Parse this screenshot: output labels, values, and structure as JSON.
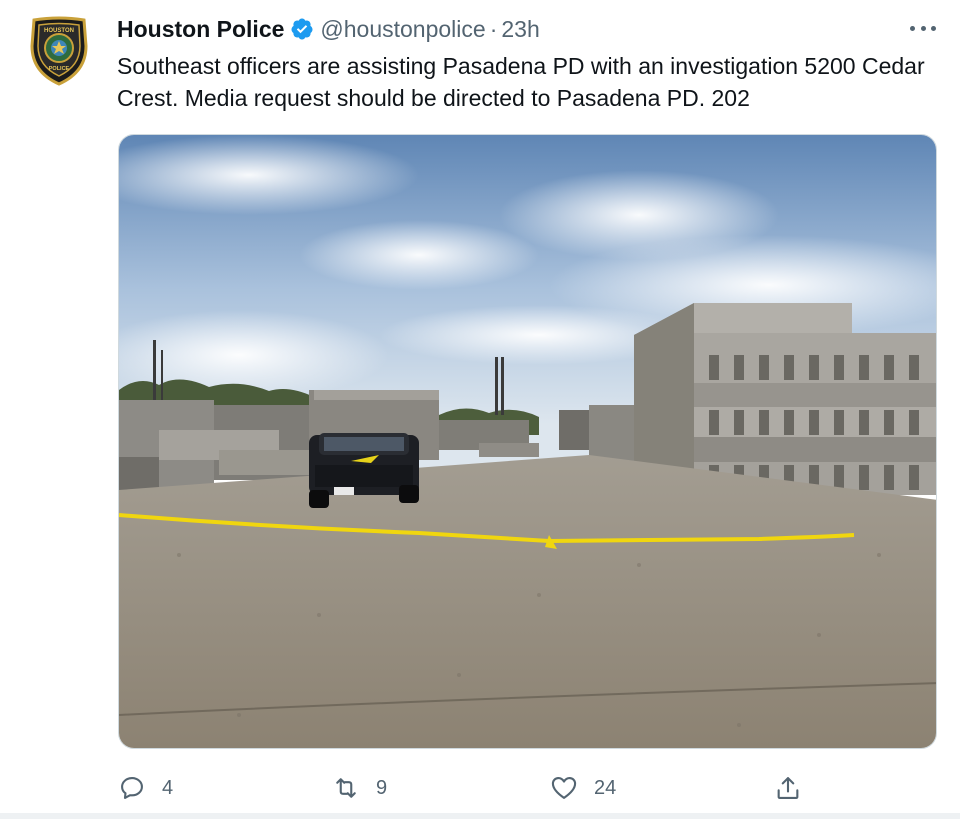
{
  "tweet": {
    "display_name": "Houston Police",
    "handle": "@houstonpolice",
    "separator": "·",
    "time": "23h",
    "text": "Southeast officers are assisting Pasadena PD with an investigation 5200 Cedar Crest. Media request should be directed to Pasadena PD. 202",
    "avatar_icon": "houston-police-badge-icon",
    "verified_icon": "verified-badge-icon",
    "verified_color": "#1d9bf0",
    "badge_text_top": "HOUSTON",
    "badge_text_bottom": "POLICE"
  },
  "media": {
    "description_icon": "photo-police-suv-crime-scene-tape"
  },
  "actions": {
    "reply_count": "4",
    "retweet_count": "9",
    "like_count": "24",
    "reply_icon": "reply-icon",
    "retweet_icon": "retweet-icon",
    "like_icon": "heart-icon",
    "share_icon": "share-icon",
    "icon_color": "#536471"
  },
  "colors": {
    "text": "#0f1419",
    "secondary": "#536471",
    "accent": "#1d9bf0"
  }
}
